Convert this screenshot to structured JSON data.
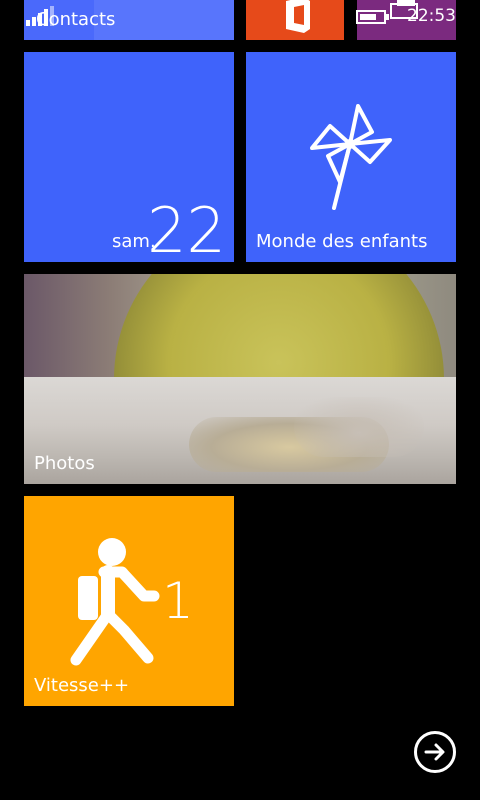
{
  "status_bar": {
    "time": "22:53",
    "signal_icon": "signal-bars-icon",
    "battery_icon": "battery-icon"
  },
  "tiles": {
    "contacts": {
      "label": "Contacts",
      "color": "#4a69fb"
    },
    "office": {
      "icon": "office-icon",
      "color": "#e64a1a"
    },
    "purple": {
      "color": "#7b2a7f"
    },
    "calendar": {
      "day": "sam.",
      "date": "22",
      "color": "#3f63fb"
    },
    "kids_corner": {
      "label": "Monde des enfants",
      "icon": "pinwheel-icon",
      "color": "#3f63fb"
    },
    "photos": {
      "label": "Photos"
    },
    "vitesse": {
      "label": "Vitesse++",
      "count": "1",
      "icon": "walking-man-icon",
      "color": "#ffa500"
    }
  },
  "navigation": {
    "next_icon": "arrow-right-circle-icon"
  }
}
